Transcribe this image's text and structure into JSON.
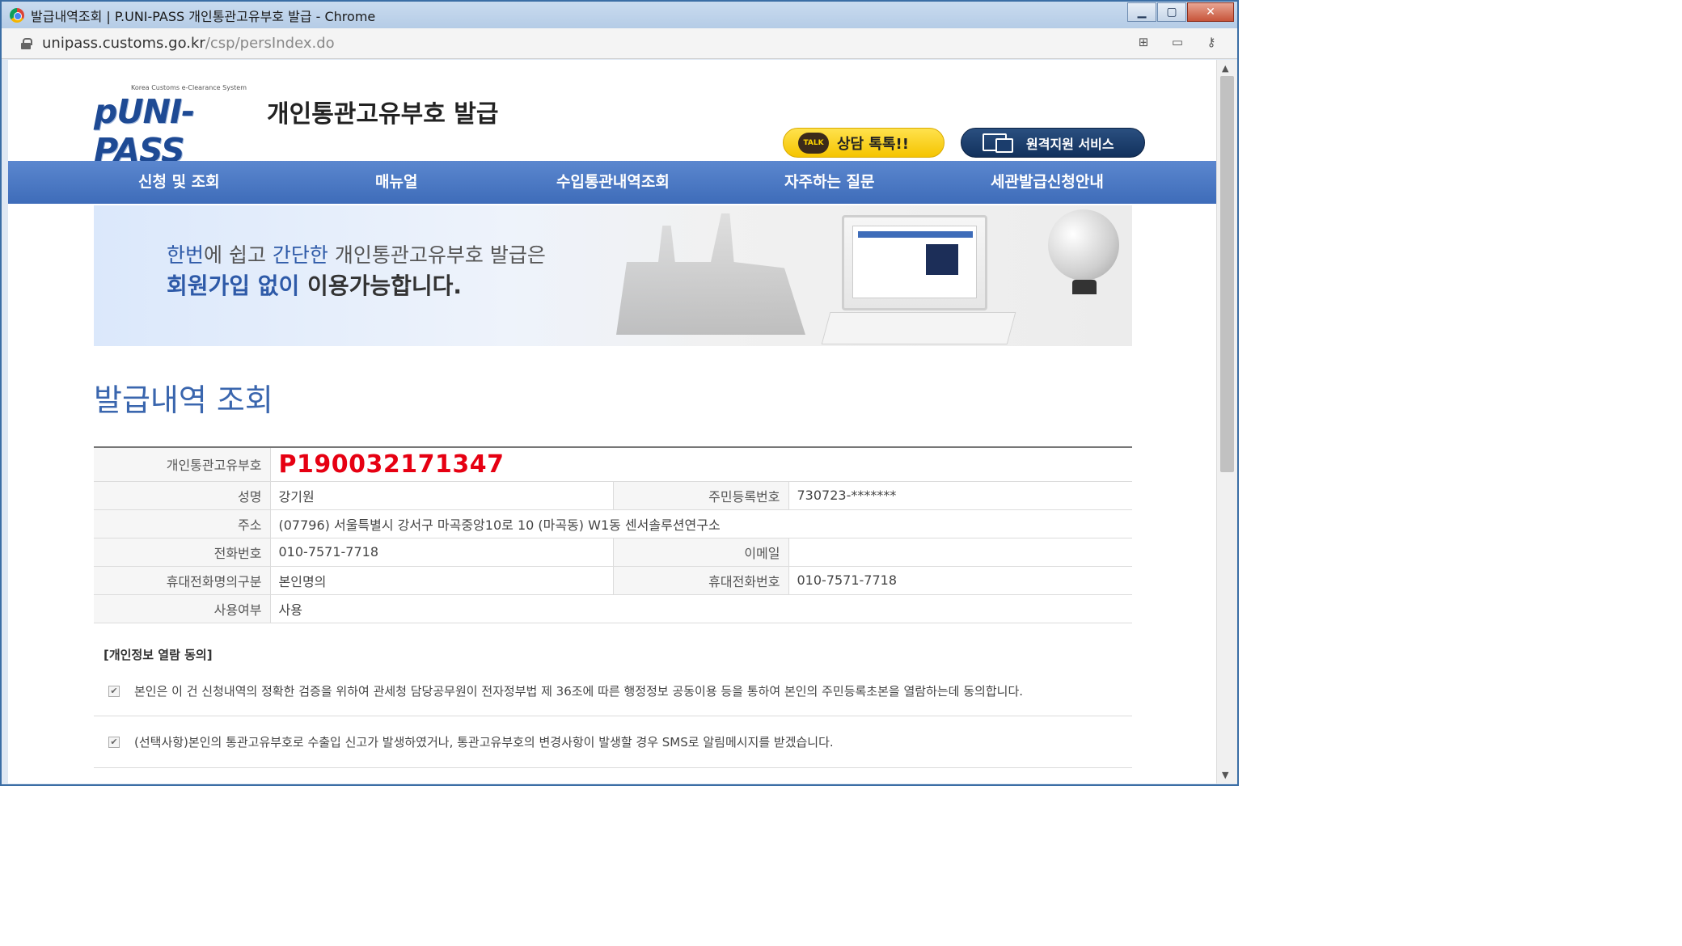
{
  "window": {
    "title": "발급내역조회 | P.UNI-PASS 개인통관고유부호 발급 - Chrome",
    "url_host": "unipass.customs.go.kr",
    "url_path": "/csp/persIndex.do",
    "controls": {
      "minimize": "▁",
      "maximize": "▢",
      "close": "✕"
    },
    "addr_icons": [
      "translate-icon",
      "cast-icon",
      "key-icon"
    ]
  },
  "header": {
    "logo_small": "Korea Customs e-Clearance System",
    "logo_main": "pUNI-PASS",
    "site_title": "개인통관고유부호 발급",
    "talk_icon_text": "TALK",
    "talk_label": "상담 톡톡!!",
    "remote_label": "원격지원 서비스"
  },
  "nav": {
    "items": [
      {
        "label": "신청 및 조회"
      },
      {
        "label": "매뉴얼"
      },
      {
        "label": "수입통관내역조회"
      },
      {
        "label": "자주하는 질문"
      },
      {
        "label": "세관발급신청안내"
      }
    ]
  },
  "banner": {
    "line1_a": "한번",
    "line1_b": "에 쉽고 ",
    "line1_c": "간단한",
    "line1_d": " 개인통관고유부호 발급은",
    "line2_a": "회원가입 없이",
    "line2_b": " 이용가능합니다."
  },
  "section": {
    "title": "발급내역 조회"
  },
  "info": {
    "unique_label": "개인통관고유부호",
    "unique_value": "P190032171347",
    "name_label": "성명",
    "name_value": "강기원",
    "rrn_label": "주민등록번호",
    "rrn_value": "730723-*******",
    "address_label": "주소",
    "address_value": "(07796)  서울특별시 강서구 마곡중앙10로 10 (마곡동) W1동 센서솔루션연구소",
    "phone_label": "전화번호",
    "phone_value": "010-7571-7718",
    "email_label": "이메일",
    "email_value": "",
    "mobile_type_label": "휴대전화명의구분",
    "mobile_type_value": "본인명의",
    "mobile_label": "휴대전화번호",
    "mobile_value": "010-7571-7718",
    "use_label": "사용여부",
    "use_value": "사용"
  },
  "agreement": {
    "heading": "[개인정보 열람 동의]",
    "item1": "본인은 이 건 신청내역의 정확한 검증을 위하여 관세청 담당공무원이 전자정부법 제 36조에 따른 행정정보 공동이용 등을 통하여 본인의 주민등록초본을 열람하는데 동의합니다.",
    "item1_checked": true,
    "item2": "(선택사항)본인의 통관고유부호로 수출입 신고가 발생하였거나, 통관고유부호의 변경사항이 발생할 경우 SMS로 알림메시지를 받겠습니다.",
    "item2_checked": true,
    "check_mark": "✔"
  },
  "scroll": {
    "up": "▲",
    "down": "▼"
  }
}
